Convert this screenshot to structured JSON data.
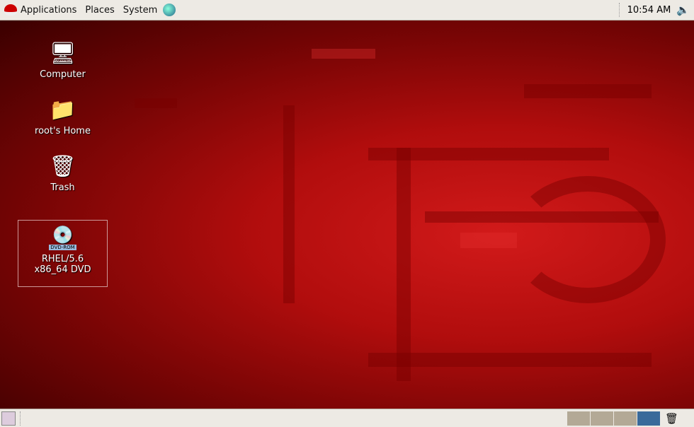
{
  "top_panel": {
    "menus": [
      "Applications",
      "Places",
      "System"
    ],
    "clock": "10:54 AM"
  },
  "desktop": {
    "icons": [
      {
        "label": "Computer",
        "icon": "computer-icon"
      },
      {
        "label": "root's Home",
        "icon": "home-folder-icon"
      },
      {
        "label": "Trash",
        "icon": "trash-icon"
      },
      {
        "label": "RHEL/5.6 x86_64 DVD",
        "icon": "dvd-icon",
        "badge": "DVD-ROM"
      }
    ]
  },
  "bottom_panel": {
    "workspaces": 4,
    "active_workspace": 4,
    "active_color": "#3a6a9a"
  }
}
